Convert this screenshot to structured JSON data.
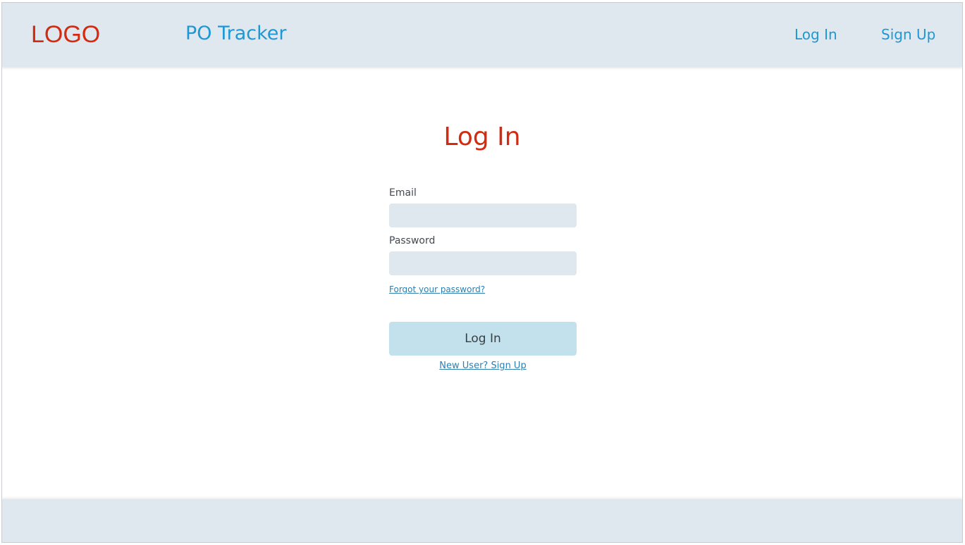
{
  "header": {
    "logo": "LOGO",
    "app_title": "PO Tracker",
    "nav": {
      "login_label": "Log In",
      "signup_label": "Sign Up"
    }
  },
  "main": {
    "title": "Log In",
    "email": {
      "label": "Email",
      "value": "",
      "placeholder": ""
    },
    "password": {
      "label": "Password",
      "value": "",
      "placeholder": ""
    },
    "forgot_link": "Forgot your password?",
    "login_button": "Log In",
    "signup_link": "New User? Sign Up"
  },
  "colors": {
    "accent_red": "#d32b12",
    "link_blue": "#1f97d4",
    "header_bg": "#dfe8ef",
    "button_bg": "#c2e1ec"
  }
}
